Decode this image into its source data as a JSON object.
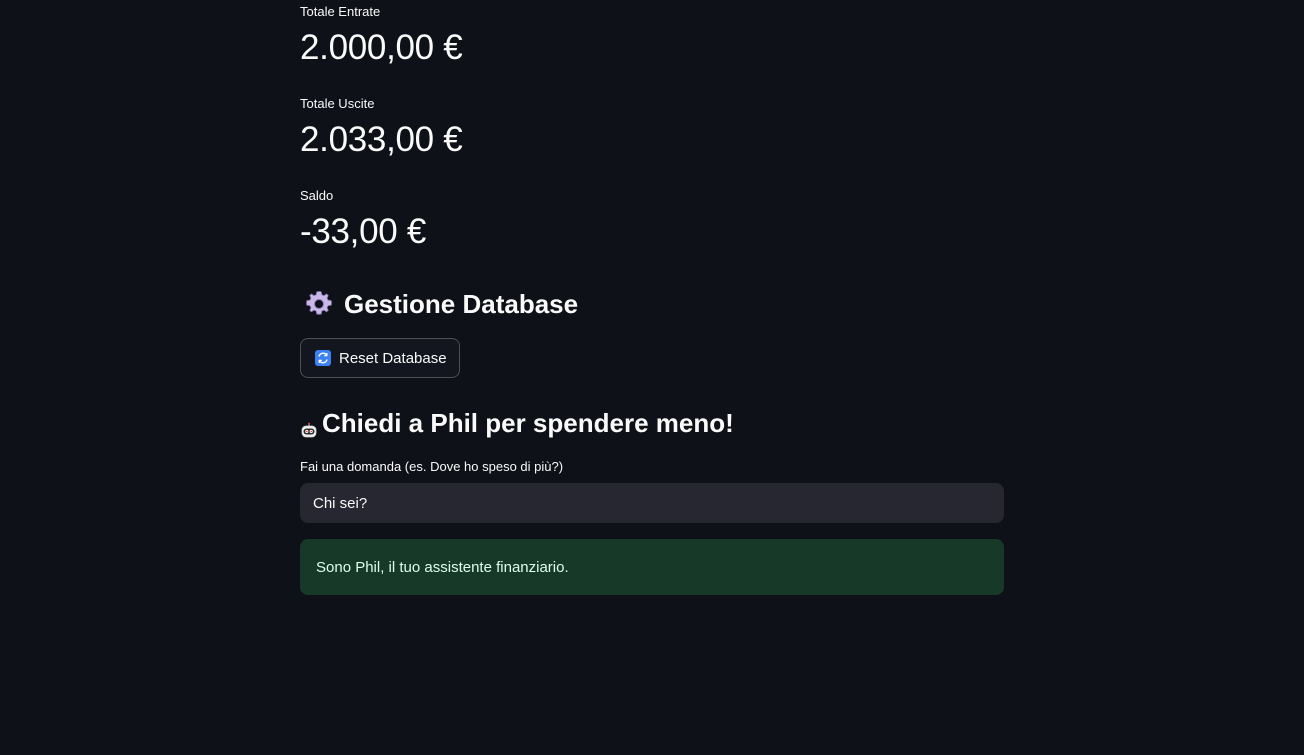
{
  "metrics": {
    "entrate": {
      "label": "Totale Entrate",
      "value": "2.000,00 €"
    },
    "uscite": {
      "label": "Totale Uscite",
      "value": "2.033,00 €"
    },
    "saldo": {
      "label": "Saldo",
      "value": "-33,00 €"
    }
  },
  "database_section": {
    "title": "Gestione Database",
    "icon": "gear-icon",
    "reset_button": {
      "label": "Reset Database",
      "icon": "refresh-icon"
    }
  },
  "chat_section": {
    "title": "Chiedi a Phil per spendere meno!",
    "icon": "robot-icon",
    "question_label": "Fai una domanda (es. Dove ho speso di più?)",
    "question_value": "Chi sei?",
    "answer": "Sono Phil, il tuo assistente finanziario."
  },
  "colors": {
    "background": "#0e1117",
    "input_background": "#262730",
    "success_background": "#173928",
    "success_text": "#dffde9"
  }
}
